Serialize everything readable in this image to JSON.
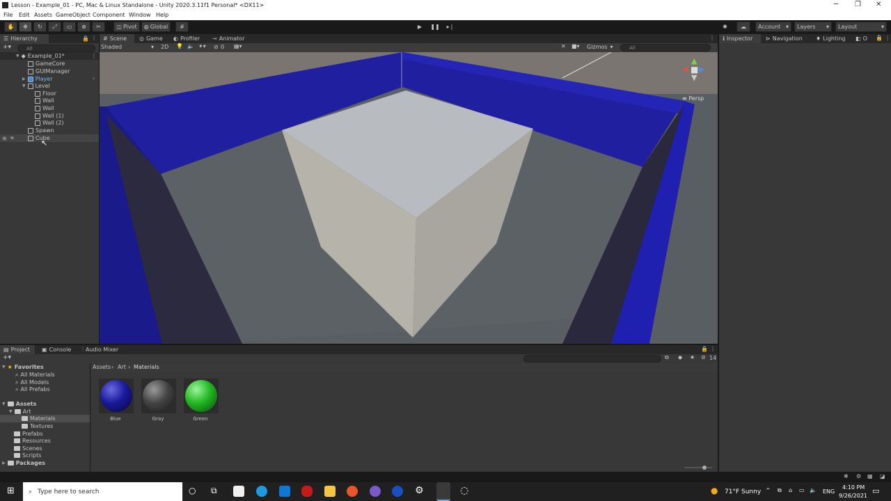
{
  "window": {
    "title": "Lesson - Example_01 - PC, Mac & Linux Standalone - Unity 2020.3.11f1 Personal* <DX11>",
    "minimize": "─",
    "restore": "❐",
    "close": "✕"
  },
  "menu": [
    "File",
    "Edit",
    "Assets",
    "GameObject",
    "Component",
    "Window",
    "Help"
  ],
  "toolbar": {
    "pivot": "Pivot",
    "global": "Global",
    "account": "Account",
    "layers": "Layers",
    "layout": "Layout"
  },
  "hierarchy": {
    "tab": "Hierarchy",
    "search_placeholder": "All",
    "scene": "Example_01*",
    "items": [
      {
        "label": "GameCore"
      },
      {
        "label": "GUIManager"
      },
      {
        "label": "Player"
      },
      {
        "label": "Level"
      },
      {
        "label": "Floor"
      },
      {
        "label": "Wall"
      },
      {
        "label": "Wall"
      },
      {
        "label": "Wall (1)"
      },
      {
        "label": "Wall (2)"
      },
      {
        "label": "Spawn"
      },
      {
        "label": "Cube"
      }
    ]
  },
  "scene_tabs": [
    "Scene",
    "Game",
    "Profiler",
    "Animator"
  ],
  "scene_toolbar": {
    "shading": "Shaded",
    "mode": "2D",
    "hidden_count": "0",
    "gizmos": "Gizmos",
    "search_placeholder": "All",
    "persp": "≡ Persp"
  },
  "inspector_tabs": [
    "Inspector",
    "Navigation",
    "Lighting",
    "O"
  ],
  "bottom_tabs": [
    "Project",
    "Console",
    "Audio Mixer"
  ],
  "project": {
    "favorites": "Favorites",
    "fav_items": [
      "All Materials",
      "All Models",
      "All Prefabs"
    ],
    "assets": "Assets",
    "tree": [
      "Art",
      "Materials",
      "Textures",
      "Prefabs",
      "Resources",
      "Scenes",
      "Scripts"
    ],
    "packages": "Packages",
    "breadcrumb": [
      "Assets",
      "Art",
      "Materials"
    ],
    "hidden_count": "14",
    "materials": [
      {
        "name": "Blue",
        "color": "#1a1a9a"
      },
      {
        "name": "Gray",
        "color": "#444444"
      },
      {
        "name": "Green",
        "color": "#22b822"
      }
    ]
  },
  "taskbar": {
    "search_placeholder": "Type here to search",
    "weather": "71°F  Sunny",
    "lang": "ENG",
    "time": "4:10 PM",
    "date": "9/26/2021"
  }
}
